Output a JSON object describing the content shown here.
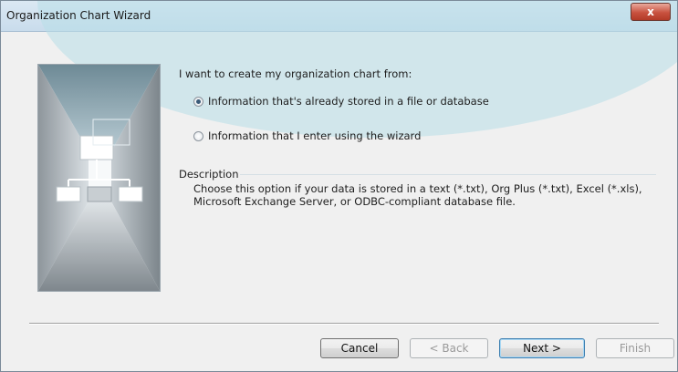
{
  "window": {
    "title": "Organization Chart Wizard",
    "close_glyph": "x"
  },
  "main": {
    "prompt": "I want to create my organization chart from:",
    "options": [
      {
        "label": "Information that's already stored in a file or database",
        "selected": true
      },
      {
        "label": "Information that I enter using the wizard",
        "selected": false
      }
    ],
    "description_label": "Description",
    "description_text_1": "Choose this option if your data is stored in a text (*.txt), Org Plus (*.txt), Excel (*.xls),",
    "description_text_2": "Microsoft Exchange Server, or ODBC-compliant database file."
  },
  "footer": {
    "cancel_label": "Cancel",
    "back_label": "< Back",
    "next_label": "Next >",
    "finish_label": "Finish"
  },
  "colors": {
    "close_button": "#c8523f",
    "default_button_border": "#3c7fb1"
  }
}
